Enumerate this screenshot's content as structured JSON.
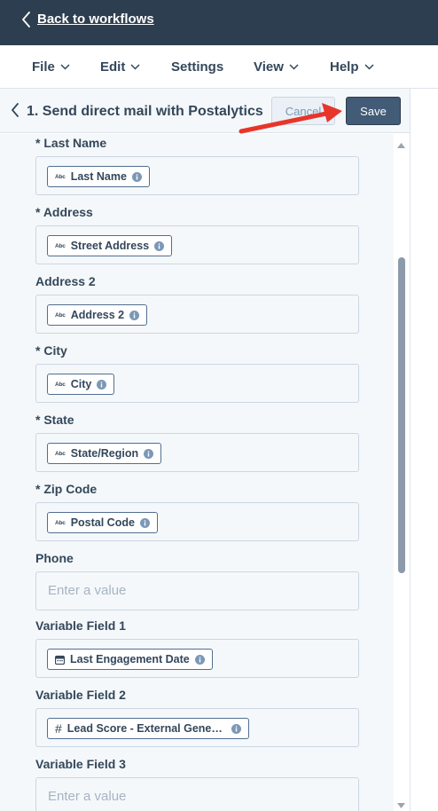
{
  "topbar": {
    "back_label": "Back to workflows"
  },
  "menu": {
    "items": [
      {
        "label": "File"
      },
      {
        "label": "Edit"
      },
      {
        "label": "Settings"
      },
      {
        "label": "View"
      },
      {
        "label": "Help"
      }
    ]
  },
  "panel": {
    "title": "1. Send direct mail with Postalytics",
    "cancel_label": "Cancel",
    "save_label": "Save"
  },
  "fields": [
    {
      "label": "* Last Name",
      "token": "Last Name",
      "token_icon": "text-icon",
      "token_icon_text": "Abc"
    },
    {
      "label": "* Address",
      "token": "Street Address",
      "token_icon": "text-icon",
      "token_icon_text": "Abc"
    },
    {
      "label": "Address 2",
      "token": "Address 2",
      "token_icon": "text-icon",
      "token_icon_text": "Abc"
    },
    {
      "label": "* City",
      "token": "City",
      "token_icon": "text-icon",
      "token_icon_text": "Abc"
    },
    {
      "label": "* State",
      "token": "State/Region",
      "token_icon": "text-icon",
      "token_icon_text": "Abc"
    },
    {
      "label": "* Zip Code",
      "token": "Postal Code",
      "token_icon": "text-icon",
      "token_icon_text": "Abc"
    },
    {
      "label": "Phone",
      "placeholder": "Enter a value"
    },
    {
      "label": "Variable Field 1",
      "token": "Last Engagement Date",
      "token_icon": "calendar-icon"
    },
    {
      "label": "Variable Field 2",
      "token": "Lead Score - External Gene…",
      "token_icon": "hash-icon",
      "token_icon_text": "#"
    },
    {
      "label": "Variable Field 3",
      "placeholder": "Enter a value"
    }
  ]
}
